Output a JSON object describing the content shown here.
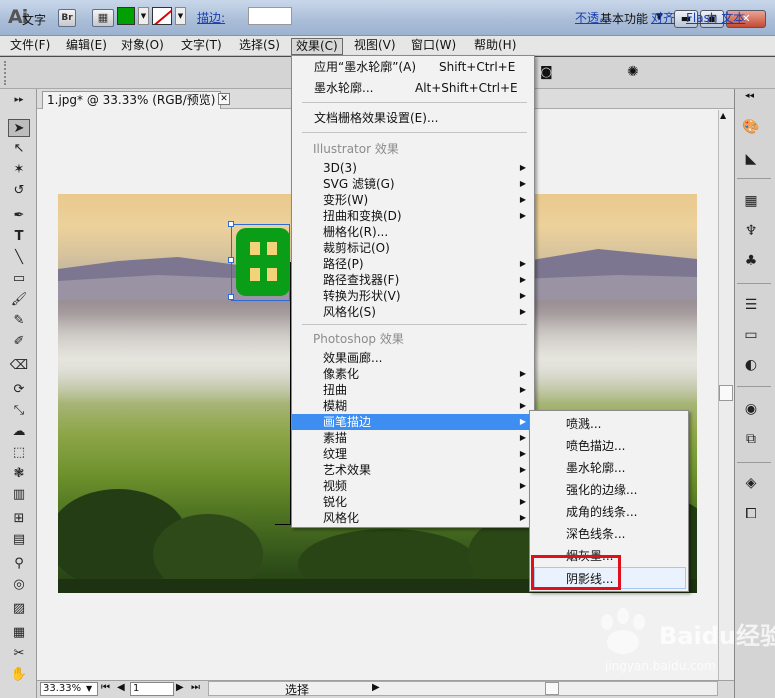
{
  "app": {
    "logo_text": "Ai",
    "bridge_label": "Br",
    "workspace": "基本功能",
    "workspace_arrow": "▼"
  },
  "menubar": {
    "items": [
      {
        "label": "文件(F)",
        "active": false
      },
      {
        "label": "编辑(E)",
        "active": false
      },
      {
        "label": "对象(O)",
        "active": false
      },
      {
        "label": "文字(T)",
        "active": false
      },
      {
        "label": "选择(S)",
        "active": false
      },
      {
        "label": "效果(C)",
        "active": true
      },
      {
        "label": "视图(V)",
        "active": false
      },
      {
        "label": "窗口(W)",
        "active": false
      },
      {
        "label": "帮助(H)",
        "active": false
      }
    ]
  },
  "controlbar": {
    "type_label": "文字",
    "stroke_label": "描边:",
    "opacity_label": "不透...",
    "align_label": "对齐",
    "flash_text_label": "Flash 文本",
    "fill_color": "#00a000",
    "stroke_color": "#d00000"
  },
  "document": {
    "tab_title": "1.jpg* @ 33.33% (RGB/预览)",
    "tab_close": "⊠",
    "zoom": "33.33%",
    "page": "1",
    "status": "选择"
  },
  "effects_menu": {
    "top_items": [
      {
        "label": "应用“墨水轮廓”(A)",
        "shortcut": "Shift+Ctrl+E"
      },
      {
        "label": "墨水轮廓...",
        "shortcut": "Alt+Shift+Ctrl+E"
      }
    ],
    "doc_raster": "文档栅格效果设置(E)...",
    "illustrator_header": "Illustrator 效果",
    "illustrator_items": [
      {
        "label": "3D(3)",
        "submenu": true
      },
      {
        "label": "SVG 滤镜(G)",
        "submenu": true
      },
      {
        "label": "变形(W)",
        "submenu": true
      },
      {
        "label": "扭曲和变换(D)",
        "submenu": true
      },
      {
        "label": "栅格化(R)...",
        "submenu": false
      },
      {
        "label": "裁剪标记(O)",
        "submenu": false
      },
      {
        "label": "路径(P)",
        "submenu": true
      },
      {
        "label": "路径查找器(F)",
        "submenu": true
      },
      {
        "label": "转换为形状(V)",
        "submenu": true
      },
      {
        "label": "风格化(S)",
        "submenu": true
      }
    ],
    "photoshop_header": "Photoshop 效果",
    "photoshop_items": [
      {
        "label": "效果画廊...",
        "submenu": false,
        "highlighted": false
      },
      {
        "label": "像素化",
        "submenu": true,
        "highlighted": false
      },
      {
        "label": "扭曲",
        "submenu": true,
        "highlighted": false
      },
      {
        "label": "模糊",
        "submenu": true,
        "highlighted": false
      },
      {
        "label": "画笔描边",
        "submenu": true,
        "highlighted": true
      },
      {
        "label": "素描",
        "submenu": true,
        "highlighted": false
      },
      {
        "label": "纹理",
        "submenu": true,
        "highlighted": false
      },
      {
        "label": "艺术效果",
        "submenu": true,
        "highlighted": false
      },
      {
        "label": "视频",
        "submenu": true,
        "highlighted": false
      },
      {
        "label": "锐化",
        "submenu": true,
        "highlighted": false
      },
      {
        "label": "风格化",
        "submenu": true,
        "highlighted": false
      }
    ],
    "submenu_arrow": "▶"
  },
  "brush_strokes_submenu": {
    "items": [
      {
        "label": "喷溅...",
        "highlighted": false
      },
      {
        "label": "喷色描边...",
        "highlighted": false
      },
      {
        "label": "墨水轮廓...",
        "highlighted": false
      },
      {
        "label": "强化的边缘...",
        "highlighted": false
      },
      {
        "label": "成角的线条...",
        "highlighted": false
      },
      {
        "label": "深色线条...",
        "highlighted": false
      },
      {
        "label": "烟灰墨...",
        "highlighted": false
      },
      {
        "label": "阴影线...",
        "highlighted": true
      }
    ],
    "callout_color": "#e0101a"
  },
  "watermark": {
    "brand": "Baidu经验",
    "url": "jingyan.baidu.com"
  }
}
